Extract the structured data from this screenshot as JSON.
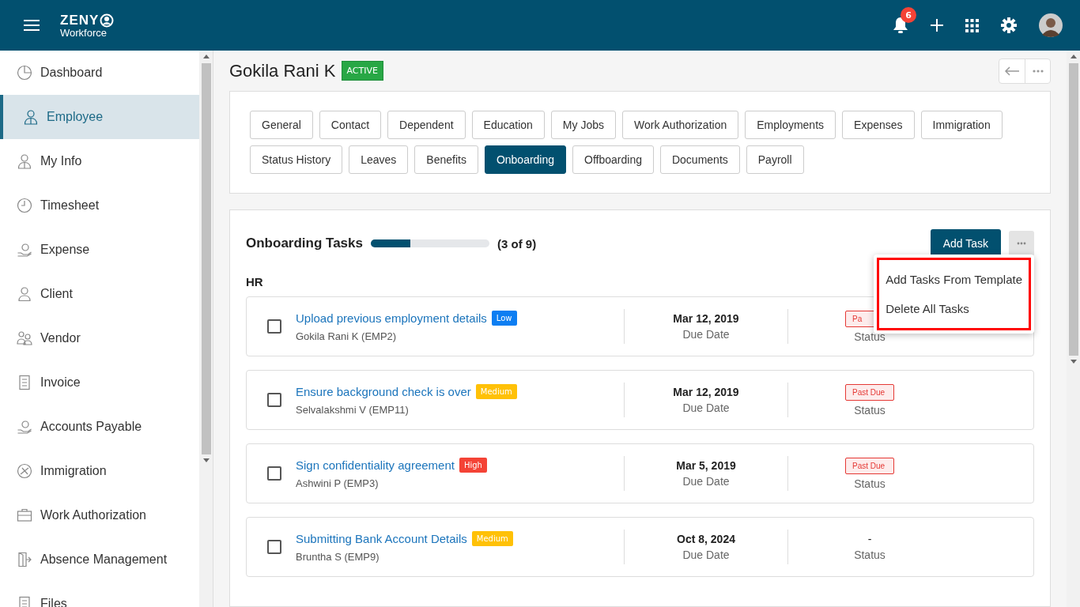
{
  "header": {
    "logo": {
      "brand": "ZENY",
      "sub": "Workforce"
    },
    "notifications": "6"
  },
  "sidebar": {
    "items": [
      {
        "label": "Dashboard",
        "selected": false
      },
      {
        "label": "Employee",
        "selected": true
      },
      {
        "label": "My Info",
        "selected": false
      },
      {
        "label": "Timesheet",
        "selected": false
      },
      {
        "label": "Expense",
        "selected": false
      },
      {
        "label": "Client",
        "selected": false
      },
      {
        "label": "Vendor",
        "selected": false
      },
      {
        "label": "Invoice",
        "selected": false
      },
      {
        "label": "Accounts Payable",
        "selected": false
      },
      {
        "label": "Immigration",
        "selected": false
      },
      {
        "label": "Work Authorization",
        "selected": false
      },
      {
        "label": "Absence Management",
        "selected": false
      },
      {
        "label": "Files",
        "selected": false
      }
    ]
  },
  "employee": {
    "name": "Gokila Rani K",
    "status": "ACTIVE"
  },
  "tabs": [
    {
      "label": "General",
      "selected": false
    },
    {
      "label": "Contact",
      "selected": false
    },
    {
      "label": "Dependent",
      "selected": false
    },
    {
      "label": "Education",
      "selected": false
    },
    {
      "label": "My Jobs",
      "selected": false
    },
    {
      "label": "Work Authorization",
      "selected": false
    },
    {
      "label": "Employments",
      "selected": false
    },
    {
      "label": "Expenses",
      "selected": false
    },
    {
      "label": "Immigration",
      "selected": false
    },
    {
      "label": "Status History",
      "selected": false
    },
    {
      "label": "Leaves",
      "selected": false
    },
    {
      "label": "Benefits",
      "selected": false
    },
    {
      "label": "Onboarding",
      "selected": true
    },
    {
      "label": "Offboarding",
      "selected": false
    },
    {
      "label": "Documents",
      "selected": false
    },
    {
      "label": "Payroll",
      "selected": false
    }
  ],
  "onboarding": {
    "title": "Onboarding Tasks",
    "level": 0.33,
    "count": "(3 of 9)",
    "add_button": "Add Task",
    "menu": [
      "Add Tasks From Template",
      "Delete All Tasks"
    ],
    "group": "HR",
    "tasks": [
      {
        "title": "Upload previous employment details",
        "priority": {
          "label": "Low",
          "color": "#0d7ef2"
        },
        "assignee": "Gokila Rani K (EMP2)",
        "date": "Mar 12, 2019",
        "date_label": "Due Date",
        "status": {
          "kind": "badge",
          "text": "Pa"
        },
        "status_label": "Status",
        "checked": false
      },
      {
        "title": "Ensure background check is over",
        "priority": {
          "label": "Medium",
          "color": "#ffc107"
        },
        "assignee": "Selvalakshmi V (EMP11)",
        "date": "Mar 12, 2019",
        "date_label": "Due Date",
        "status": {
          "kind": "badge",
          "text": "Past Due"
        },
        "status_label": "Status",
        "checked": false
      },
      {
        "title": "Sign confidentiality agreement",
        "priority": {
          "label": "High",
          "color": "#f44336"
        },
        "assignee": "Ashwini P (EMP3)",
        "date": "Mar 5, 2019",
        "date_label": "Due Date",
        "status": {
          "kind": "badge",
          "text": "Past Due"
        },
        "status_label": "Status",
        "checked": false
      },
      {
        "title": "Submitting Bank Account Details",
        "priority": {
          "label": "Medium",
          "color": "#ffc107"
        },
        "assignee": "Bruntha S (EMP9)",
        "date": "Oct 8, 2024",
        "date_label": "Due Date",
        "status": {
          "kind": "plain",
          "text": "-"
        },
        "status_label": "Status",
        "checked": false
      }
    ]
  }
}
